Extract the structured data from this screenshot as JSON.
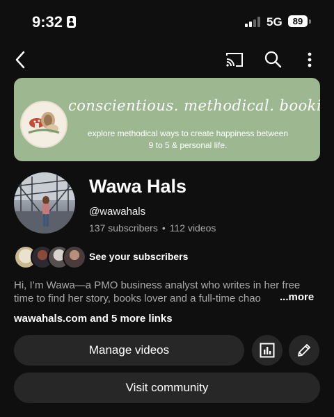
{
  "status_bar": {
    "time": "9:32",
    "network": "5G",
    "battery": "89"
  },
  "app_bar": {
    "icons": [
      "back-icon",
      "cast-icon",
      "search-icon",
      "more-vertical-icon"
    ]
  },
  "banner": {
    "tagline": "conscientious. methodical. bookish.",
    "subtitle_line1": "explore methodical ways to create happiness between",
    "subtitle_line2": "9 to 5 & personal life.",
    "background_color": "#9db891"
  },
  "channel": {
    "name": "Wawa Hals",
    "handle": "@wawahals",
    "subscribers": "137 subscribers",
    "separator": "•",
    "videos": "112 videos",
    "see_subscribers": "See your subscribers",
    "description_line1": "Hi, I’m Wawa—a PMO business analyst who writes in her free",
    "description_line2": "time to find her story, books lover and a full-time chao",
    "more": "...more",
    "links": "wawahals.com and 5 more links"
  },
  "actions": {
    "manage_videos": "Manage videos",
    "visit_community": "Visit community",
    "icons": [
      "analytics-icon",
      "edit-pencil-icon"
    ]
  },
  "colors": {
    "background": "#0f0f0f",
    "button": "#272727",
    "secondary_text": "#aaaaaa"
  }
}
